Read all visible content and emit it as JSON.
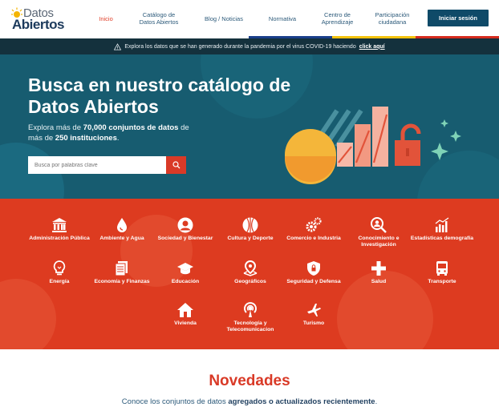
{
  "header": {
    "logo_line1": "Datos",
    "logo_line2": "Abiertos",
    "nav": [
      {
        "label": "Inicio"
      },
      {
        "label": "Catálogo de Datos Abiertos"
      },
      {
        "label": "Blog / Noticias"
      },
      {
        "label": "Normativa"
      },
      {
        "label": "Centro de Aprendizaje"
      },
      {
        "label": "Participación ciudadana"
      }
    ],
    "login_label": "Iniciar sesión",
    "flag_colors": [
      "#1a3f8a",
      "#f4c20d",
      "#d52b1e"
    ]
  },
  "alert": {
    "text": "Explora los datos que se han generado durante la pandemia por el virus COVID-19 haciendo",
    "link": "click aquí"
  },
  "hero": {
    "title": "Busca en nuestro catálogo de Datos Abiertos",
    "desc_pre": "Explora más de ",
    "desc_count": "70,000 conjuntos de datos",
    "desc_mid": " de más de ",
    "desc_inst": "250 instituciones",
    "desc_end": ".",
    "search_placeholder": "Busca por palabras clave",
    "bg_color": "#175c70"
  },
  "categories": [
    {
      "label": "Administración Pública",
      "icon": "building-icon"
    },
    {
      "label": "Ambiente y Agua",
      "icon": "water-drop-icon"
    },
    {
      "label": "Sociedad y Bienestar",
      "icon": "person-icon"
    },
    {
      "label": "Cultura y Deporte",
      "icon": "ball-icon"
    },
    {
      "label": "Comercio e Industria",
      "icon": "gears-icon"
    },
    {
      "label": "Conocimiento e Investigación",
      "icon": "magnifier-person-icon"
    },
    {
      "label": "Estadísticas demografía",
      "icon": "bar-chart-icon"
    },
    {
      "label": "Energía",
      "icon": "lightbulb-icon"
    },
    {
      "label": "Economía y Finanzas",
      "icon": "documents-icon"
    },
    {
      "label": "Educación",
      "icon": "graduation-cap-icon"
    },
    {
      "label": "Geográficos",
      "icon": "map-pin-icon"
    },
    {
      "label": "Seguridad y Defensa",
      "icon": "shield-icon"
    },
    {
      "label": "Salud",
      "icon": "health-cross-icon"
    },
    {
      "label": "Transporte",
      "icon": "bus-icon"
    },
    {
      "label": "Vivienda",
      "icon": "house-icon"
    },
    {
      "label": "Tecnología y Telecomunicacion",
      "icon": "antenna-icon"
    },
    {
      "label": "Turismo",
      "icon": "airplane-icon"
    }
  ],
  "novedades": {
    "title": "Novedades",
    "sub_pre": "Conoce los conjuntos de datos ",
    "sub_bold": "agregados o actualizados recientemente",
    "sub_end": "."
  }
}
